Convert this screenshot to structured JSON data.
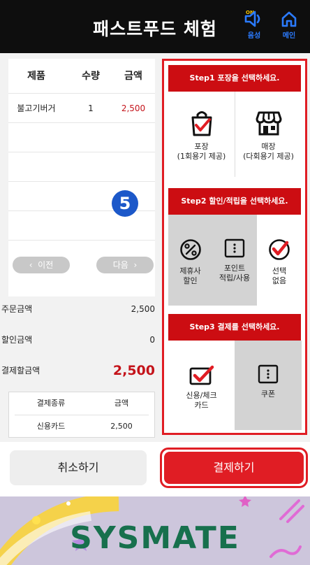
{
  "header": {
    "title": "패스트푸드 체험",
    "sound_badge": "ON",
    "sound_label": "음성",
    "home_label": "메인"
  },
  "order": {
    "columns": [
      "제품",
      "수량",
      "금액"
    ],
    "rows": [
      {
        "product": "불고기버거",
        "qty": "1",
        "price": "2,500"
      }
    ],
    "prev_label": "이전",
    "next_label": "다음",
    "step_number": "5"
  },
  "summary": {
    "order_amount_label": "주문금액",
    "order_amount": "2,500",
    "discount_label": "할인금액",
    "discount": "0",
    "payable_label": "결제할금액",
    "payable": "2,500"
  },
  "payment_table": {
    "columns": [
      "결제종류",
      "금액"
    ],
    "rows": [
      {
        "type": "신용카드",
        "amount": "2,500"
      }
    ]
  },
  "steps": {
    "step1": {
      "title": "Step1 포장을 선택하세요.",
      "options": [
        {
          "label": "포장",
          "sub": "(1회용기 제공)",
          "icon": "takeout-bag-check-icon"
        },
        {
          "label": "매장",
          "sub": "(다회용기 제공)",
          "icon": "store-icon"
        }
      ]
    },
    "step2": {
      "title": "Step2 할인/적립을 선택하세요.",
      "options": [
        {
          "line1": "제휴사",
          "line2": "할인",
          "icon": "percent-icon"
        },
        {
          "line1": "포인트",
          "line2": "적립/사용",
          "icon": "card-dots-icon"
        },
        {
          "line1": "선택",
          "line2": "없음",
          "icon": "check-circle-icon"
        }
      ]
    },
    "step3": {
      "title": "Step3 결제를 선택하세요.",
      "options": [
        {
          "line1": "신용/체크",
          "line2": "카드",
          "icon": "card-check-icon"
        },
        {
          "line1": "쿠폰",
          "line2": "",
          "icon": "coupon-icon"
        }
      ]
    }
  },
  "buttons": {
    "cancel": "취소하기",
    "pay": "결제하기"
  },
  "banner": {
    "logo": "SYSMATE"
  },
  "colors": {
    "accent_red": "#e01d24",
    "step_bar_red": "#cc0d12",
    "header_bg": "#0e0e0e",
    "icon_blue": "#2b7bff",
    "logo_green": "#17704d"
  }
}
